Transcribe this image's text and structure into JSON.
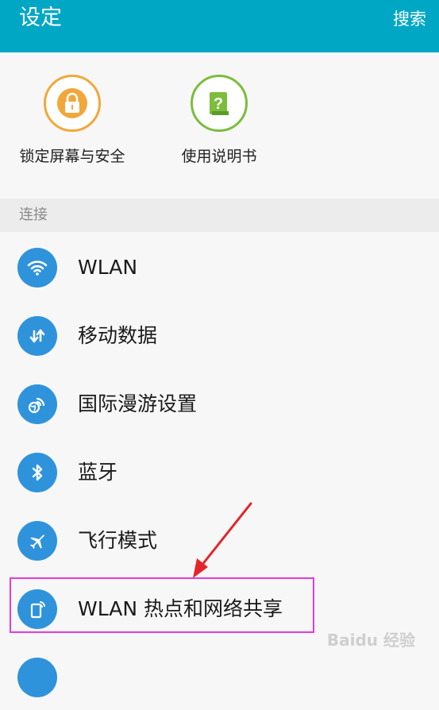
{
  "header": {
    "title": "设定",
    "search_label": "搜索",
    "background": "#00a7c4"
  },
  "favorites": [
    {
      "label": "锁定屏幕与安全",
      "icon": "lock-icon",
      "color": "#f2a73b"
    },
    {
      "label": "使用说明书",
      "icon": "help-book-icon",
      "color": "#7cbd3c"
    }
  ],
  "section": {
    "title": "连接"
  },
  "connection_items": [
    {
      "label": "WLAN",
      "icon": "wifi-icon"
    },
    {
      "label": "移动数据",
      "icon": "data-arrows-icon"
    },
    {
      "label": "国际漫游设置",
      "icon": "roaming-globe-icon"
    },
    {
      "label": "蓝牙",
      "icon": "bluetooth-icon"
    },
    {
      "label": "飞行模式",
      "icon": "airplane-icon"
    },
    {
      "label": "WLAN 热点和网络共享",
      "icon": "hotspot-icon"
    }
  ],
  "icon_color": "#2f93dc",
  "highlight_color": "#e03be0",
  "arrow_color": "#e5242a",
  "watermark": "Baidu 经验"
}
